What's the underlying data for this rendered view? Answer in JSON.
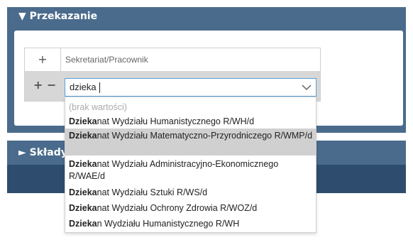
{
  "sections": {
    "przekazanie_title": "Przekazanie",
    "przekazanie_arrow": "▼",
    "sklady_title": "Składy",
    "sklady_arrow": "►"
  },
  "grid": {
    "add_symbol": "+",
    "column_label": "Sekretariat/Pracownik",
    "row_add_symbol": "+",
    "row_remove_symbol": "−"
  },
  "select": {
    "value": "dzieka",
    "chevron_icon": "chevron-down-icon"
  },
  "dropdown": {
    "empty_option": "(brak wartości)",
    "match": "Dzieka",
    "options": [
      {
        "bold": "Dzieka",
        "rest": "nat Wydziału Humanistycznego R/WH/d"
      },
      {
        "bold": "Dzieka",
        "rest": "nat Wydziału Matematyczno-Przyrodniczego R/WMP/d"
      },
      {
        "bold": "Dzieka",
        "rest": "nat Wydziału Administracyjno-Ekonomicznego R/WAE/d"
      },
      {
        "bold": "Dzieka",
        "rest": "nat Wydziału Sztuki R/WS/d"
      },
      {
        "bold": "Dzieka",
        "rest": "nat Wydziału Ochrony Zdrowia R/WOZ/d"
      },
      {
        "bold": "Dzieka",
        "rest": "n Wydziału Humanistycznego R/WH"
      }
    ],
    "highlighted_index": 1
  },
  "colors": {
    "header_bg": "#4a6b8c",
    "band_bg": "#2e4d6e",
    "select_border": "#5b9fd6",
    "highlight_bg": "#d0d0d0"
  }
}
